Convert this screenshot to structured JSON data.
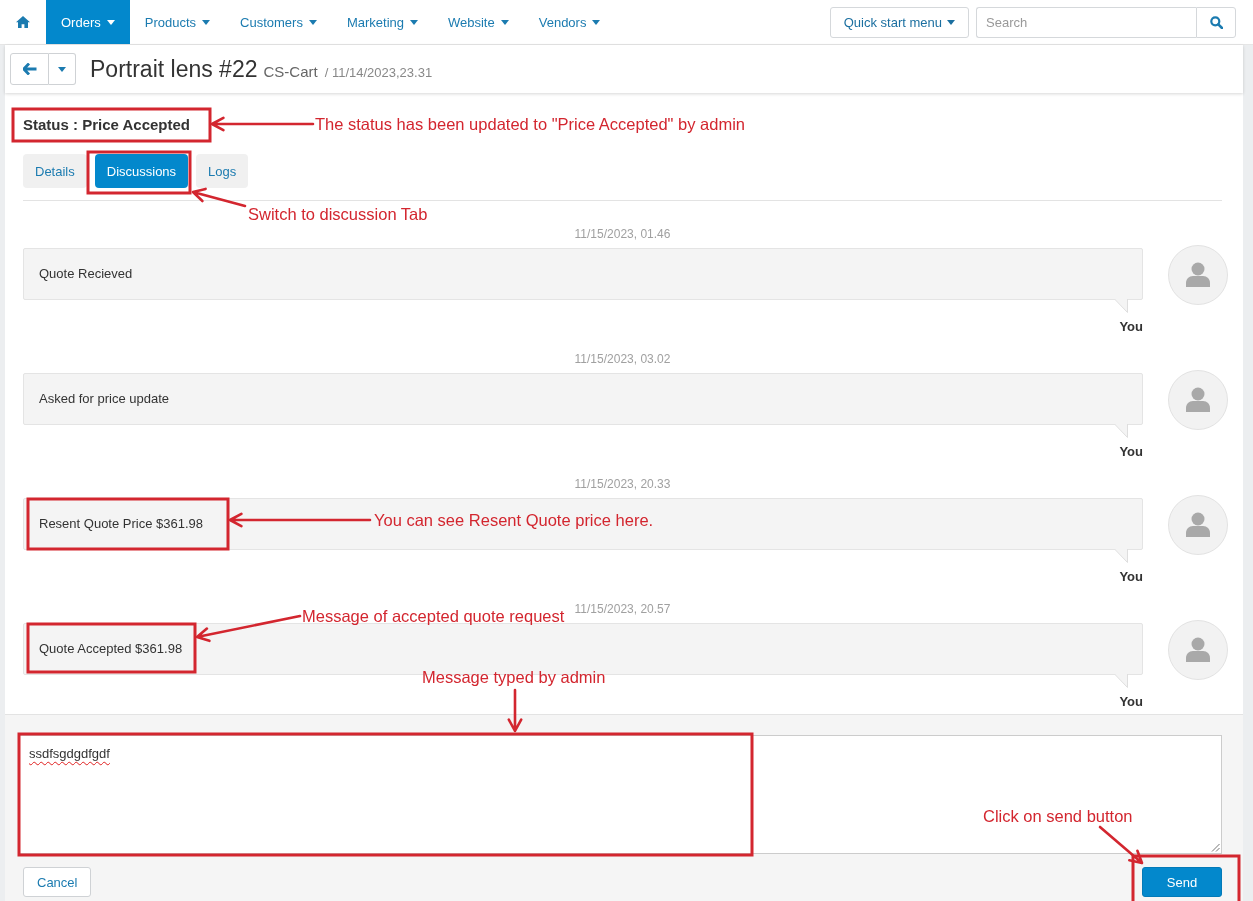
{
  "nav": {
    "items": [
      {
        "label": "Orders",
        "selected": true
      },
      {
        "label": "Products",
        "selected": false
      },
      {
        "label": "Customers",
        "selected": false
      },
      {
        "label": "Marketing",
        "selected": false
      },
      {
        "label": "Website",
        "selected": false
      },
      {
        "label": "Vendors",
        "selected": false
      }
    ],
    "quick_start_menu": "Quick start menu",
    "search": {
      "placeholder": "Search"
    }
  },
  "header": {
    "title": "Portrait lens #22",
    "store": "CS-Cart",
    "date": "/ 11/14/2023,23.31"
  },
  "status": "Status : Price Accepted",
  "tabs": [
    {
      "label": "Details",
      "selected": false
    },
    {
      "label": "Discussions",
      "selected": true
    },
    {
      "label": "Logs",
      "selected": false
    }
  ],
  "messages": [
    {
      "time": "11/15/2023, 01.46",
      "text": "Quote Recieved",
      "author": "You"
    },
    {
      "time": "11/15/2023, 03.02",
      "text": "Asked for price update",
      "author": "You"
    },
    {
      "time": "11/15/2023, 20.33",
      "text": "Resent Quote Price $361.98",
      "author": "You"
    },
    {
      "time": "11/15/2023, 20.57",
      "text": "Quote Accepted $361.98",
      "author": "You"
    }
  ],
  "composer": {
    "value": "ssdfsgdgdfgdf",
    "spelling_flagged": true,
    "cancel": "Cancel",
    "send": "Send"
  },
  "annotations": [
    {
      "text": "The status has been updated to \"Price Accepted\" by admin"
    },
    {
      "text": "Switch to discussion Tab"
    },
    {
      "text": "You can see Resent Quote price here."
    },
    {
      "text": "Message of accepted quote request"
    },
    {
      "text": "Message typed by admin"
    },
    {
      "text": "Click on send button"
    }
  ]
}
